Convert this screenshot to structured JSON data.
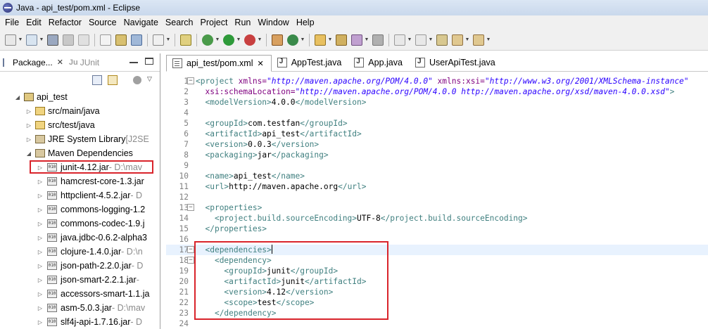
{
  "window": {
    "title": "Java - api_test/pom.xml - Eclipse"
  },
  "menu": [
    {
      "label": "File",
      "mnemonic": "F",
      "rest": "ile"
    },
    {
      "label": "Edit",
      "mnemonic": "E",
      "rest": "dit"
    },
    {
      "label": "Refactor",
      "mnemonic": "",
      "rest": "Refactor"
    },
    {
      "label": "Source",
      "mnemonic": "S",
      "rest": "ource"
    },
    {
      "label": "Navigate",
      "mnemonic": "N",
      "rest": "avigate"
    },
    {
      "label": "Search",
      "mnemonic": "",
      "rest": "Search"
    },
    {
      "label": "Project",
      "mnemonic": "P",
      "rest": "roject"
    },
    {
      "label": "Run",
      "mnemonic": "R",
      "rest": "un"
    },
    {
      "label": "Window",
      "mnemonic": "W",
      "rest": "indow"
    },
    {
      "label": "Help",
      "mnemonic": "H",
      "rest": "elp"
    }
  ],
  "left_panel": {
    "tab_package": "Package...",
    "tab_close": "✕",
    "tab_junit": "JUnit",
    "tree": [
      {
        "level": 0,
        "arrow": "◢",
        "icon": "project-icon",
        "label": "api_test",
        "sub": ""
      },
      {
        "level": 1,
        "arrow": "▷",
        "icon": "source-folder-icon",
        "label": "src/main/java",
        "sub": ""
      },
      {
        "level": 1,
        "arrow": "▷",
        "icon": "source-folder-icon",
        "label": "src/test/java",
        "sub": ""
      },
      {
        "level": 1,
        "arrow": "▷",
        "icon": "library-icon",
        "label": "JRE System Library",
        "sub": " [J2SE"
      },
      {
        "level": 1,
        "arrow": "◢",
        "icon": "library-icon",
        "label": "Maven Dependencies",
        "sub": ""
      },
      {
        "level": 2,
        "arrow": "▷",
        "icon": "jar-icon",
        "label": "junit-4.12.jar",
        "sub": " - D:\\mav"
      },
      {
        "level": 2,
        "arrow": "▷",
        "icon": "jar-icon",
        "label": "hamcrest-core-1.3.jar",
        "sub": ""
      },
      {
        "level": 2,
        "arrow": "▷",
        "icon": "jar-icon",
        "label": "httpclient-4.5.2.jar",
        "sub": " - D"
      },
      {
        "level": 2,
        "arrow": "▷",
        "icon": "jar-icon",
        "label": "commons-logging-1.2",
        "sub": ""
      },
      {
        "level": 2,
        "arrow": "▷",
        "icon": "jar-icon",
        "label": "commons-codec-1.9.j",
        "sub": ""
      },
      {
        "level": 2,
        "arrow": "▷",
        "icon": "jar-icon",
        "label": "java.jdbc-0.6.2-alpha3",
        "sub": ""
      },
      {
        "level": 2,
        "arrow": "▷",
        "icon": "jar-icon",
        "label": "clojure-1.4.0.jar",
        "sub": " - D:\\n"
      },
      {
        "level": 2,
        "arrow": "▷",
        "icon": "jar-icon",
        "label": "json-path-2.2.0.jar",
        "sub": " - D"
      },
      {
        "level": 2,
        "arrow": "▷",
        "icon": "jar-icon",
        "label": "json-smart-2.2.1.jar",
        "sub": " - "
      },
      {
        "level": 2,
        "arrow": "▷",
        "icon": "jar-icon",
        "label": "accessors-smart-1.1.ja",
        "sub": ""
      },
      {
        "level": 2,
        "arrow": "▷",
        "icon": "jar-icon",
        "label": "asm-5.0.3.jar",
        "sub": " - D:\\mav"
      },
      {
        "level": 2,
        "arrow": "▷",
        "icon": "jar-icon",
        "label": "slf4j-api-1.7.16.jar",
        "sub": " - D"
      }
    ]
  },
  "editor": {
    "tabs": [
      {
        "label": "api_test/pom.xml",
        "icon": "xml-file-icon",
        "active": true,
        "close": "✕"
      },
      {
        "label": "AppTest.java",
        "icon": "java-file-icon",
        "active": false
      },
      {
        "label": "App.java",
        "icon": "java-file-icon",
        "active": false
      },
      {
        "label": "UserApiTest.java",
        "icon": "java-file-icon",
        "active": false
      }
    ],
    "lines": [
      {
        "n": "1",
        "fold": "⊖",
        "segs": [
          [
            "t",
            "<project "
          ],
          [
            "a",
            "xmlns="
          ],
          [
            "v",
            "\"http://maven.apache.org/POM/4.0.0\""
          ],
          [
            "tx",
            " "
          ],
          [
            "a",
            "xmlns:xsi="
          ],
          [
            "v",
            "\"http://www.w3.org/2001/XMLSchema-instance\""
          ]
        ]
      },
      {
        "n": "2",
        "segs": [
          [
            "tx",
            "  "
          ],
          [
            "a",
            "xsi:schemaLocation="
          ],
          [
            "v",
            "\"http://maven.apache.org/POM/4.0.0 http://maven.apache.org/xsd/maven-4.0.0.xsd\""
          ],
          [
            "t",
            ">"
          ]
        ]
      },
      {
        "n": "3",
        "segs": [
          [
            "tx",
            "  "
          ],
          [
            "t",
            "<modelVersion>"
          ],
          [
            "tx",
            "4.0.0"
          ],
          [
            "t",
            "</modelVersion>"
          ]
        ]
      },
      {
        "n": "4",
        "segs": []
      },
      {
        "n": "5",
        "segs": [
          [
            "tx",
            "  "
          ],
          [
            "t",
            "<groupId>"
          ],
          [
            "tx",
            "com.testfan"
          ],
          [
            "t",
            "</groupId>"
          ]
        ]
      },
      {
        "n": "6",
        "segs": [
          [
            "tx",
            "  "
          ],
          [
            "t",
            "<artifactId>"
          ],
          [
            "tx",
            "api_test"
          ],
          [
            "t",
            "</artifactId>"
          ]
        ]
      },
      {
        "n": "7",
        "segs": [
          [
            "tx",
            "  "
          ],
          [
            "t",
            "<version>"
          ],
          [
            "tx",
            "0.0.3"
          ],
          [
            "t",
            "</version>"
          ]
        ]
      },
      {
        "n": "8",
        "segs": [
          [
            "tx",
            "  "
          ],
          [
            "t",
            "<packaging>"
          ],
          [
            "tx",
            "jar"
          ],
          [
            "t",
            "</packaging>"
          ]
        ]
      },
      {
        "n": "9",
        "segs": []
      },
      {
        "n": "10",
        "segs": [
          [
            "tx",
            "  "
          ],
          [
            "t",
            "<name>"
          ],
          [
            "tx",
            "api_test"
          ],
          [
            "t",
            "</name>"
          ]
        ]
      },
      {
        "n": "11",
        "segs": [
          [
            "tx",
            "  "
          ],
          [
            "t",
            "<url>"
          ],
          [
            "tx",
            "http://maven.apache.org"
          ],
          [
            "t",
            "</url>"
          ]
        ]
      },
      {
        "n": "12",
        "segs": []
      },
      {
        "n": "13",
        "fold": "⊖",
        "segs": [
          [
            "tx",
            "  "
          ],
          [
            "t",
            "<properties>"
          ]
        ]
      },
      {
        "n": "14",
        "segs": [
          [
            "tx",
            "    "
          ],
          [
            "t",
            "<project.build.sourceEncoding>"
          ],
          [
            "tx",
            "UTF-8"
          ],
          [
            "t",
            "</project.build.sourceEncoding>"
          ]
        ]
      },
      {
        "n": "15",
        "segs": [
          [
            "tx",
            "  "
          ],
          [
            "t",
            "</properties>"
          ]
        ]
      },
      {
        "n": "16",
        "segs": []
      },
      {
        "n": "17",
        "fold": "⊖",
        "cursor": true,
        "segs": [
          [
            "tx",
            "  "
          ],
          [
            "t",
            "<dependencies>"
          ]
        ]
      },
      {
        "n": "18",
        "fold": "⊖",
        "segs": [
          [
            "tx",
            "    "
          ],
          [
            "t",
            "<dependency>"
          ]
        ]
      },
      {
        "n": "19",
        "segs": [
          [
            "tx",
            "      "
          ],
          [
            "t",
            "<groupId>"
          ],
          [
            "tx",
            "junit"
          ],
          [
            "t",
            "</groupId>"
          ]
        ]
      },
      {
        "n": "20",
        "segs": [
          [
            "tx",
            "      "
          ],
          [
            "t",
            "<artifactId>"
          ],
          [
            "tx",
            "junit"
          ],
          [
            "t",
            "</artifactId>"
          ]
        ]
      },
      {
        "n": "21",
        "segs": [
          [
            "tx",
            "      "
          ],
          [
            "t",
            "<version>"
          ],
          [
            "tx",
            "4.12"
          ],
          [
            "t",
            "</version>"
          ]
        ]
      },
      {
        "n": "22",
        "segs": [
          [
            "tx",
            "      "
          ],
          [
            "t",
            "<scope>"
          ],
          [
            "tx",
            "test"
          ],
          [
            "t",
            "</scope>"
          ]
        ]
      },
      {
        "n": "23",
        "segs": [
          [
            "tx",
            "    "
          ],
          [
            "t",
            "</dependency>"
          ]
        ]
      },
      {
        "n": "24",
        "segs": []
      }
    ]
  },
  "colors": {
    "highlight": "#d9242b",
    "tag": "#3f7f7f",
    "attr": "#7f007f",
    "value": "#2a00ff"
  }
}
